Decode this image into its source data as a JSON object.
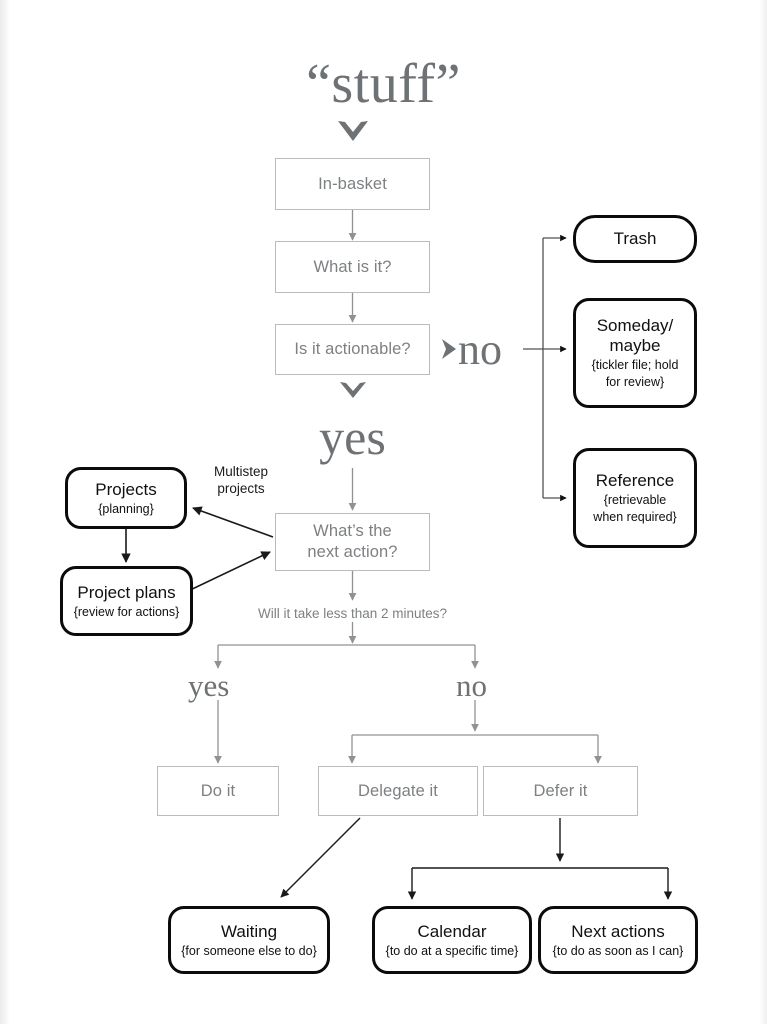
{
  "diagram": {
    "title": "“stuff”",
    "nodes": {
      "in_basket": {
        "label": "In-basket"
      },
      "what_is_it": {
        "label": "What is it?"
      },
      "is_actionable": {
        "label": "Is it actionable?"
      },
      "trash": {
        "label": "Trash"
      },
      "someday": {
        "label": "Someday/\nmaybe",
        "line1": "Someday/",
        "line2": "maybe",
        "sub1": "{tickler file; hold",
        "sub2": "for review}"
      },
      "reference": {
        "label": "Reference",
        "sub1": "{retrievable",
        "sub2": "when required}"
      },
      "projects": {
        "label": "Projects",
        "sub": "{planning}"
      },
      "project_plans": {
        "label": "Project plans",
        "sub": "{review for actions}"
      },
      "next_action": {
        "line1": "What’s the",
        "line2": "next action?"
      },
      "do_it": {
        "label": "Do it"
      },
      "delegate_it": {
        "label": "Delegate it"
      },
      "defer_it": {
        "label": "Defer it"
      },
      "waiting": {
        "label": "Waiting",
        "sub": "{for someone else to do}"
      },
      "calendar": {
        "label": "Calendar",
        "sub": "{to do at a specific time}"
      },
      "next_actions": {
        "label": "Next actions",
        "sub": "{to do as soon as I can}"
      }
    },
    "labels": {
      "branch_no_top": "no",
      "branch_yes_top": "yes",
      "multistep_line1": "Multistep",
      "multistep_line2": "projects",
      "two_minutes_question": "Will it take less than 2 minutes?",
      "branch_yes_bottom": "yes",
      "branch_no_bottom": "no"
    },
    "colors": {
      "page_background": "#ffffff",
      "thin_box_border": "#b9bcbe",
      "thin_box_text": "#7d8083",
      "heavy_box_border": "#0b0b0b",
      "heavy_box_text": "#101010",
      "grey_connector": "#8f9294",
      "black_connector": "#1a1a1a",
      "serif_word": "#6f7275"
    }
  }
}
